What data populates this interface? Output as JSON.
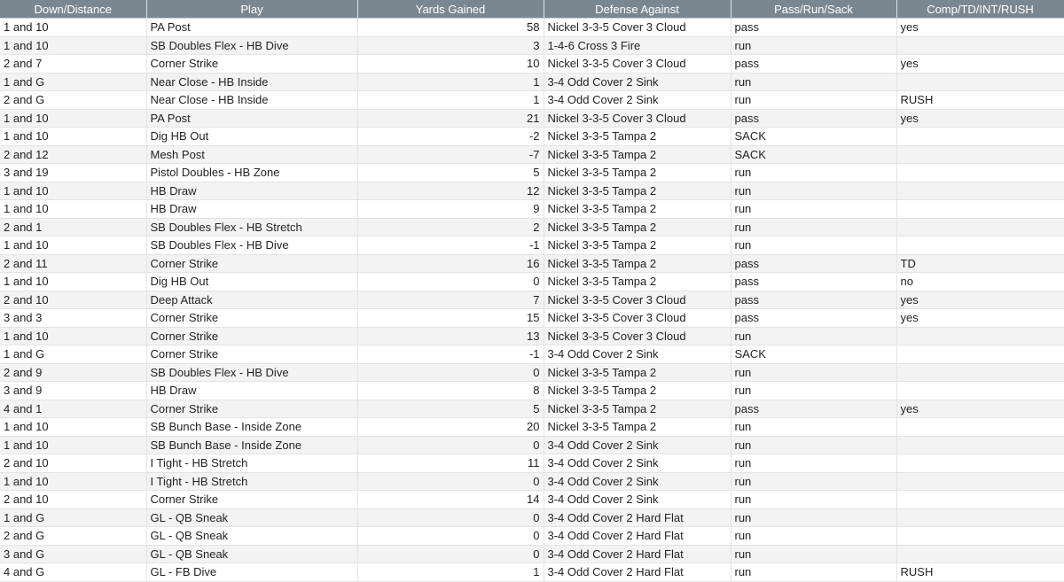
{
  "table": {
    "headers": [
      "Down/Distance",
      "Play",
      "Yards Gained",
      "Defense Against",
      "Pass/Run/Sack",
      "Comp/TD/INT/RUSH"
    ],
    "rows": [
      [
        "1 and 10",
        "PA Post",
        "58",
        "Nickel 3-3-5 Cover 3 Cloud",
        "pass",
        "yes"
      ],
      [
        "1 and 10",
        "SB Doubles Flex - HB Dive",
        "3",
        "1-4-6 Cross 3 Fire",
        "run",
        ""
      ],
      [
        "2 and 7",
        "Corner Strike",
        "10",
        "Nickel 3-3-5 Cover 3 Cloud",
        "pass",
        "yes"
      ],
      [
        "1 and G",
        "Near Close - HB Inside",
        "1",
        "3-4 Odd Cover 2 Sink",
        "run",
        ""
      ],
      [
        "2 and G",
        "Near Close - HB Inside",
        "1",
        "3-4 Odd Cover 2 Sink",
        "run",
        "RUSH"
      ],
      [
        "1 and 10",
        "PA Post",
        "21",
        "Nickel 3-3-5 Cover 3 Cloud",
        "pass",
        "yes"
      ],
      [
        "1 and 10",
        "Dig HB Out",
        "-2",
        "Nickel 3-3-5 Tampa 2",
        "SACK",
        ""
      ],
      [
        "2 and 12",
        "Mesh Post",
        "-7",
        "Nickel 3-3-5 Tampa 2",
        "SACK",
        ""
      ],
      [
        "3 and 19",
        "Pistol Doubles - HB Zone",
        "5",
        "Nickel 3-3-5 Tampa 2",
        "run",
        ""
      ],
      [
        "1 and 10",
        "HB Draw",
        "12",
        "Nickel 3-3-5 Tampa 2",
        "run",
        ""
      ],
      [
        "1 and 10",
        "HB Draw",
        "9",
        "Nickel 3-3-5 Tampa 2",
        "run",
        ""
      ],
      [
        "2 and 1",
        "SB Doubles Flex - HB Stretch",
        "2",
        "Nickel 3-3-5 Tampa 2",
        "run",
        ""
      ],
      [
        "1 and 10",
        "SB Doubles Flex - HB Dive",
        "-1",
        "Nickel 3-3-5 Tampa 2",
        "run",
        ""
      ],
      [
        "2 and 11",
        "Corner Strike",
        "16",
        "Nickel 3-3-5 Tampa 2",
        "pass",
        "TD"
      ],
      [
        "1 and 10",
        "Dig HB Out",
        "0",
        "Nickel 3-3-5 Tampa 2",
        "pass",
        "no"
      ],
      [
        "2 and 10",
        "Deep Attack",
        "7",
        "Nickel 3-3-5 Cover 3 Cloud",
        "pass",
        "yes"
      ],
      [
        "3 and 3",
        "Corner Strike",
        "15",
        "Nickel 3-3-5 Cover 3 Cloud",
        "pass",
        "yes"
      ],
      [
        "1 and 10",
        "Corner Strike",
        "13",
        "Nickel 3-3-5 Cover 3 Cloud",
        "run",
        ""
      ],
      [
        "1 and G",
        "Corner Strike",
        "-1",
        "3-4 Odd Cover 2 Sink",
        "SACK",
        ""
      ],
      [
        "2 and 9",
        "SB Doubles Flex - HB Dive",
        "0",
        "Nickel 3-3-5 Tampa 2",
        "run",
        ""
      ],
      [
        "3 and 9",
        "HB Draw",
        "8",
        "Nickel 3-3-5 Tampa 2",
        "run",
        ""
      ],
      [
        "4 and 1",
        "Corner Strike",
        "5",
        "Nickel 3-3-5 Tampa 2",
        "pass",
        "yes"
      ],
      [
        "1 and 10",
        "SB Bunch Base - Inside Zone",
        "20",
        "Nickel 3-3-5 Tampa 2",
        "run",
        ""
      ],
      [
        "1 and 10",
        "SB Bunch Base - Inside Zone",
        "0",
        "3-4 Odd Cover 2 Sink",
        "run",
        ""
      ],
      [
        "2 and 10",
        "I Tight - HB Stretch",
        "11",
        "3-4 Odd Cover 2 Sink",
        "run",
        ""
      ],
      [
        "1 and 10",
        "I Tight - HB Stretch",
        "0",
        "3-4 Odd Cover 2 Sink",
        "run",
        ""
      ],
      [
        "2 and 10",
        "Corner Strike",
        "14",
        "3-4 Odd Cover 2 Sink",
        "run",
        ""
      ],
      [
        "1 and G",
        "GL - QB Sneak",
        "0",
        "3-4 Odd Cover 2 Hard Flat",
        "run",
        ""
      ],
      [
        "2 and G",
        "GL - QB Sneak",
        "0",
        "3-4 Odd Cover 2 Hard Flat",
        "run",
        ""
      ],
      [
        "3 and G",
        "GL - QB Sneak",
        "0",
        "3-4 Odd Cover 2 Hard Flat",
        "run",
        ""
      ],
      [
        "4 and G",
        "GL - FB Dive",
        "1",
        "3-4 Odd Cover 2 Hard Flat",
        "run",
        "RUSH"
      ]
    ]
  }
}
